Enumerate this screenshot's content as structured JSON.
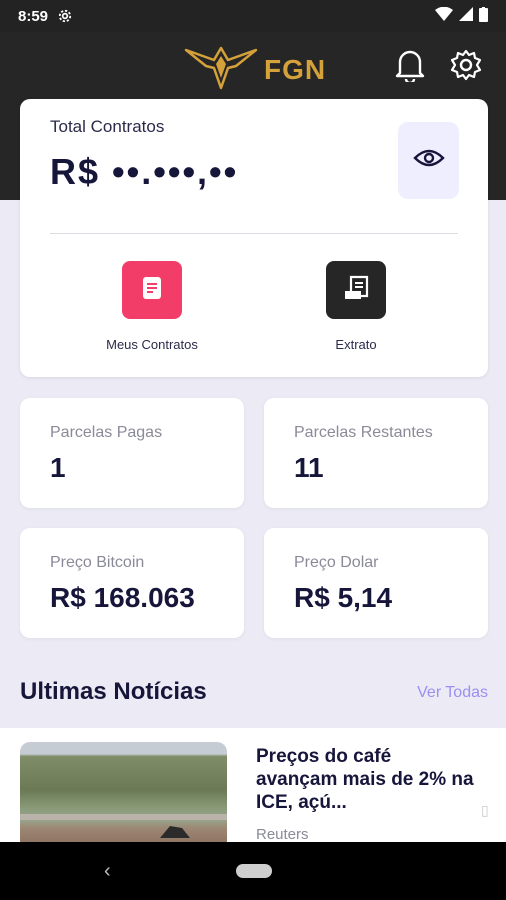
{
  "status_bar": {
    "time": "8:59"
  },
  "header": {
    "brand": "FGN",
    "accent_color": "#d4a13a"
  },
  "total_card": {
    "label": "Total Contratos",
    "value": "R$ ••.•••,••",
    "actions": [
      {
        "label": "Meus Contratos",
        "icon": "document-icon",
        "color": "#f23d69"
      },
      {
        "label": "Extrato",
        "icon": "receipt-icon",
        "color": "#262626"
      }
    ]
  },
  "stats": [
    {
      "label": "Parcelas Pagas",
      "value": "1"
    },
    {
      "label": "Parcelas Restantes",
      "value": "11"
    },
    {
      "label": "Preço Bitcoin",
      "value": "R$ 168.063"
    },
    {
      "label": "Preço Dolar",
      "value": "R$ 5,14"
    }
  ],
  "news_section": {
    "title": "Ultimas Notícias",
    "see_all": "Ver Todas",
    "items": [
      {
        "headline": "Preços do café avançam mais de 2% na ICE, açú...",
        "source": "Reuters"
      }
    ]
  },
  "colors": {
    "dark": "#262626",
    "primary_text": "#16153a",
    "link": "#9b8ff0",
    "background": "#ecebf5"
  }
}
